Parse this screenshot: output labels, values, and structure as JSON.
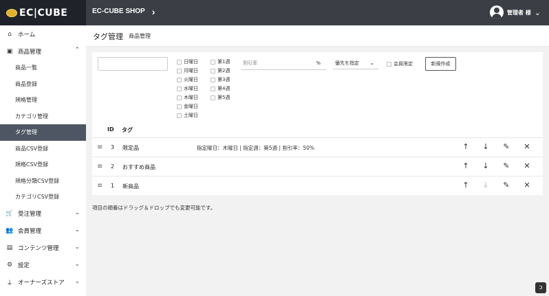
{
  "header": {
    "logo": "EC|CUBE",
    "shop_name": "EC-CUBE SHOP",
    "shop_chevron": "›",
    "user_name": "管理者 様",
    "user_chevron": "⌄"
  },
  "sidebar": {
    "home": {
      "icon": "⌂",
      "label": "ホーム"
    },
    "product": {
      "icon": "▣",
      "label": "商品管理",
      "chevron": "⌃"
    },
    "sub_items": [
      "商品一覧",
      "商品登録",
      "規格管理",
      "カテゴリ管理",
      "タグ管理",
      "商品CSV登録",
      "規格CSV登録",
      "規格分類CSV登録",
      "カテゴリCSV登録"
    ],
    "active_index": 4,
    "other_items": [
      {
        "icon": "🛒",
        "label": "受注管理",
        "chevron": "⌄"
      },
      {
        "icon": "👥",
        "label": "会員管理",
        "chevron": "⌄"
      },
      {
        "icon": "▤",
        "label": "コンテンツ管理",
        "chevron": "⌄"
      },
      {
        "icon": "⚙",
        "label": "設定",
        "chevron": "⌄"
      },
      {
        "icon": "⏚",
        "label": "オーナーズストア",
        "chevron": "⌄"
      }
    ]
  },
  "page": {
    "title": "タグ管理",
    "subtitle": "商品管理"
  },
  "form": {
    "days": [
      "日曜日",
      "月曜日",
      "火曜日",
      "水曜日",
      "木曜日",
      "金曜日",
      "土曜日"
    ],
    "weeks": [
      "第1週",
      "第2週",
      "第3週",
      "第4週",
      "第5週"
    ],
    "rate_placeholder": "割引率",
    "rate_unit": "%",
    "rank_select": "優先を指定",
    "rank_chevron": "⌄",
    "member_only": "会員限定",
    "new_button": "新規作成"
  },
  "table": {
    "headers": {
      "id": "ID",
      "tag": "タグ"
    },
    "rows": [
      {
        "id": "3",
        "name": "限定品",
        "desc": "指定曜日：木曜日 | 指定週：第5週 | 割引率：50%",
        "down_disabled": false
      },
      {
        "id": "2",
        "name": "おすすめ商品",
        "desc": "",
        "down_disabled": false
      },
      {
        "id": "1",
        "name": "新商品",
        "desc": "",
        "down_disabled": true
      }
    ],
    "icons": {
      "handle": "≡",
      "up": "↑",
      "down": "↓",
      "edit": "✎",
      "delete": "✕"
    }
  },
  "footnote": "項目の順番はドラッグ＆ドロップでも変更可能です。",
  "corner_badge": "ↄ"
}
